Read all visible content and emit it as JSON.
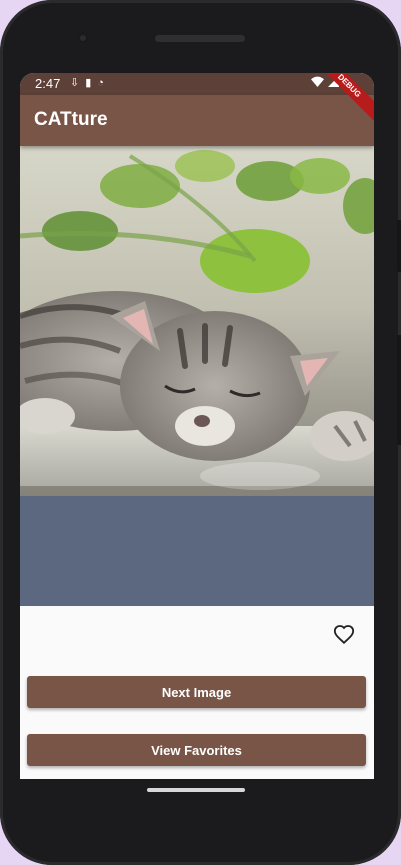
{
  "status_bar": {
    "time": "2:47"
  },
  "app_bar": {
    "title": "CATture",
    "debug_banner": "DEBUG"
  },
  "main": {
    "next_button_label": "Next Image",
    "view_favorites_label": "View Favorites"
  },
  "colors": {
    "status_bar": "#5d4037",
    "app_bar": "#795548",
    "button": "#795548",
    "debug_banner": "#b71c1c"
  },
  "icons": [
    "wifi-icon",
    "signal-icon",
    "battery-icon",
    "heart-outline-icon"
  ]
}
